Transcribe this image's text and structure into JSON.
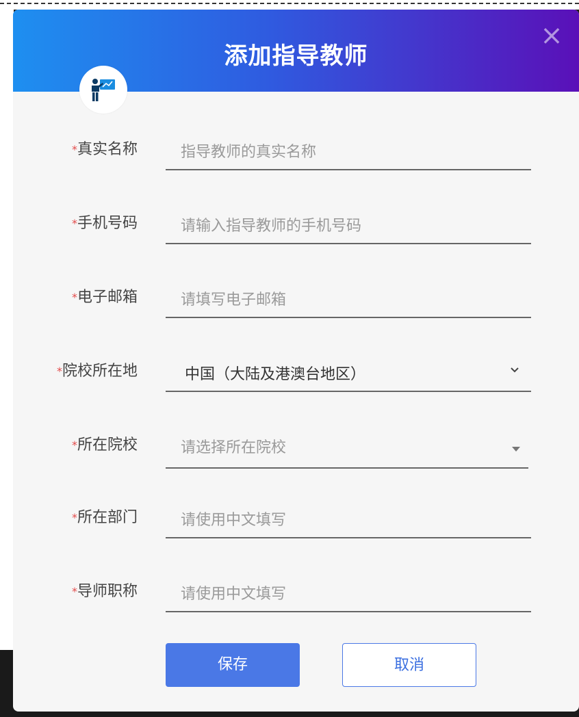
{
  "dialog": {
    "title": "添加指导教师",
    "close_symbol": "×",
    "avatar_icon": "teacher-presentation-icon"
  },
  "form": {
    "required_mark": "*",
    "fields": [
      {
        "label": "真实名称",
        "placeholder": "指导教师的真实名称",
        "value": ""
      },
      {
        "label": "手机号码",
        "placeholder": "请输入指导教师的手机号码",
        "value": ""
      },
      {
        "label": "电子邮箱",
        "placeholder": "请填写电子邮箱",
        "value": ""
      },
      {
        "label": "院校所在地",
        "selected": "中国（大陆及港澳台地区）"
      },
      {
        "label": "所在院校",
        "placeholder": "请选择所在院校",
        "value": ""
      },
      {
        "label": "所在部门",
        "placeholder": "请使用中文填写",
        "value": ""
      },
      {
        "label": "导师职称",
        "placeholder": "请使用中文填写",
        "value": ""
      }
    ]
  },
  "buttons": {
    "save": "保存",
    "cancel": "取消"
  },
  "colors": {
    "header_start": "#1e8ff0",
    "header_end": "#5a10b8",
    "primary": "#4a78e6",
    "required": "#e34b4b"
  }
}
